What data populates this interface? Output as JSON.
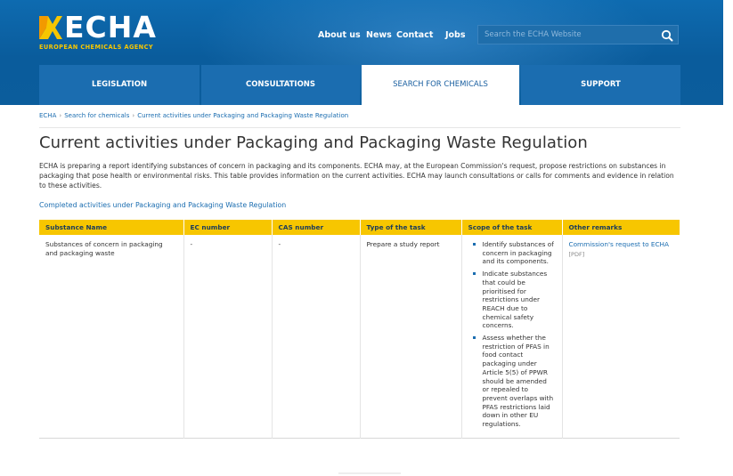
{
  "header": {
    "logo_word": "ECHA",
    "logo_sub": "EUROPEAN CHEMICALS AGENCY",
    "top_links": [
      "About us",
      "News",
      "Contact",
      "Jobs"
    ],
    "search_placeholder": "Search the ECHA Website",
    "colors": {
      "brand_blue": "#0e6bb0",
      "accent_yellow": "#f7c600"
    }
  },
  "mainnav": {
    "tabs": [
      {
        "label": "LEGISLATION",
        "active": false
      },
      {
        "label": "CONSULTATIONS",
        "active": false
      },
      {
        "label": "SEARCH FOR CHEMICALS",
        "active": true
      },
      {
        "label": "SUPPORT",
        "active": false
      }
    ]
  },
  "breadcrumb": [
    "ECHA",
    "Search for chemicals",
    "Current activities under Packaging and Packaging Waste Regulation"
  ],
  "page": {
    "title": "Current activities under Packaging and Packaging Waste Regulation",
    "intro": "ECHA is preparing a report identifying substances of concern in packaging and its components. ECHA may, at the European Commission's request, propose restrictions on substances in packaging that pose health or environmental risks. This table provides information on the current activities. ECHA may launch consultations or calls for comments and evidence in relation to these activities.",
    "completed_link": "Completed activities under Packaging and Packaging Waste Regulation"
  },
  "table": {
    "headers": [
      "Substance Name",
      "EC number",
      "CAS number",
      "Type of the task",
      "Scope of the task",
      "Other remarks"
    ],
    "rows": [
      {
        "substance": "Substances of concern in packaging and packaging waste",
        "ec": "-",
        "cas": "-",
        "task_type": "Prepare a study report",
        "scope": [
          "Identify substances of concern in packaging and its components.",
          "Indicate substances that could be prioritised for restrictions under REACH due to chemical safety concerns.",
          "Assess whether the restriction of PFAS in food contact packaging under Article 5(5) of PPWR should be amended or repealed to prevent overlaps with PFAS restrictions laid down in other EU regulations."
        ],
        "remark_link": "Commission's request to ECHA",
        "remark_tag": "[PDF]"
      }
    ]
  }
}
